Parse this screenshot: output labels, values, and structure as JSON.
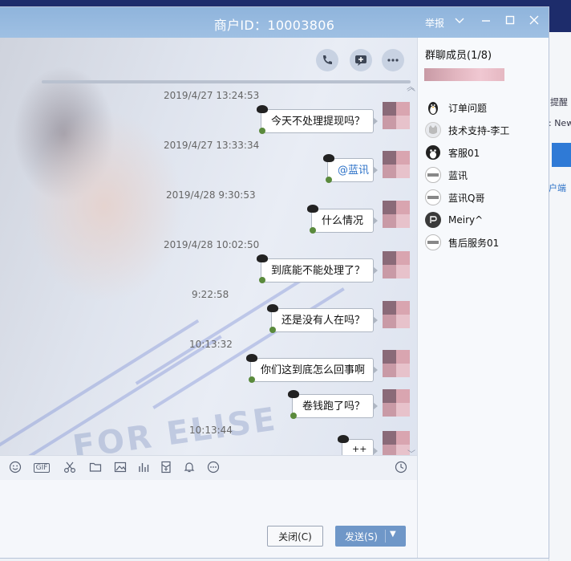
{
  "window": {
    "title": "商户ID：10003806",
    "report_label": "举报"
  },
  "background_window": {
    "text_1": "提醒",
    "text_2": ": New",
    "text_3": "户端"
  },
  "messages": [
    {
      "time": "2019/4/27 13:24:53",
      "text": "今天不处理提现吗？"
    },
    {
      "time": "2019/4/27 13:33:34",
      "text": "@蓝讯"
    },
    {
      "time": "2019/4/28 9:30:53",
      "text": "什么情况"
    },
    {
      "time": "2019/4/28 10:02:50",
      "text": "到底能不能处理了？"
    },
    {
      "time": "9:22:58",
      "text": "还是没有人在吗？"
    },
    {
      "time": "10:13:32",
      "text": "你们这到底怎么回事啊"
    },
    {
      "time": "",
      "text": "卷钱跑了吗？"
    },
    {
      "time": "10:13:44",
      "text": "++"
    }
  ],
  "toolbar": {
    "close_label": "关闭(C)",
    "send_label": "发送(S)",
    "gif_label": "GIF"
  },
  "members": {
    "title": "群聊成员(1/8)",
    "list": [
      {
        "name": "订单问题",
        "icon": "penguin-icon"
      },
      {
        "name": "技术支持-李工",
        "icon": "cat-avatar-icon"
      },
      {
        "name": "客服01",
        "icon": "penguin-icon"
      },
      {
        "name": "蓝讯",
        "icon": "default-avatar-icon"
      },
      {
        "name": "蓝讯Q哥",
        "icon": "default-avatar-icon"
      },
      {
        "name": "Meiry^",
        "icon": "dark-avatar-icon"
      },
      {
        "name": "售后服务01",
        "icon": "default-avatar-icon"
      }
    ]
  },
  "watermark": "FOR ELISE"
}
